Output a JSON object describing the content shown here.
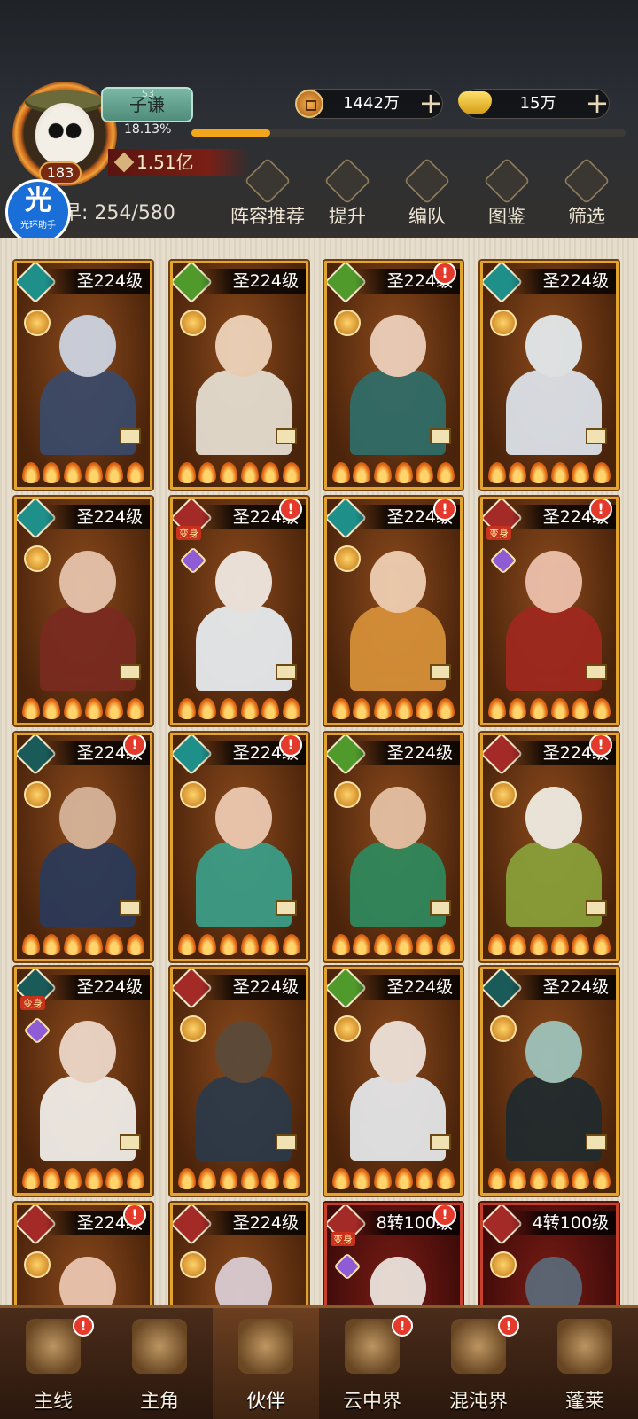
{
  "player": {
    "name": "子谦",
    "name_sup": "S3",
    "level": "183",
    "exp_percent_text": "18.13%",
    "exp_fraction": 0.1813,
    "power": "1.51亿",
    "capacity": "254/580",
    "capacity_prefix": "早"
  },
  "currency": {
    "copper": "1442万",
    "gold": "15万"
  },
  "helper_badge": {
    "glyph": "光",
    "label": "光环助手"
  },
  "header_buttons": [
    "阵容推荐",
    "提升",
    "编队",
    "图鉴",
    "筛选"
  ],
  "cards": [
    {
      "level": "圣224级",
      "elem": "teal",
      "alert": false
    },
    {
      "level": "圣224级",
      "elem": "green",
      "alert": false
    },
    {
      "level": "圣224级",
      "elem": "green",
      "alert": true
    },
    {
      "level": "圣224级",
      "elem": "teal",
      "alert": false
    },
    {
      "level": "圣224级",
      "elem": "teal",
      "alert": false
    },
    {
      "level": "圣224级",
      "elem": "red",
      "alert": true,
      "transform": "变身"
    },
    {
      "level": "圣224级",
      "elem": "teal",
      "alert": true
    },
    {
      "level": "圣224级",
      "elem": "red",
      "alert": true,
      "transform": "变身"
    },
    {
      "level": "圣224级",
      "elem": "dark",
      "alert": true
    },
    {
      "level": "圣224级",
      "elem": "teal",
      "alert": true
    },
    {
      "level": "圣224级",
      "elem": "green",
      "alert": false
    },
    {
      "level": "圣224级",
      "elem": "red",
      "alert": true
    },
    {
      "level": "圣224级",
      "elem": "dark",
      "alert": false,
      "transform": "变身"
    },
    {
      "level": "圣224级",
      "elem": "red",
      "alert": false
    },
    {
      "level": "圣224级",
      "elem": "green",
      "alert": false
    },
    {
      "level": "圣224级",
      "elem": "dark",
      "alert": false
    },
    {
      "level": "圣224级",
      "elem": "red",
      "alert": true
    },
    {
      "level": "圣224级",
      "elem": "red",
      "alert": false
    },
    {
      "level": "8转100级",
      "elem": "red",
      "alert": true,
      "transform": "变身",
      "red": true
    },
    {
      "level": "4转100级",
      "elem": "red",
      "alert": false,
      "red": true
    }
  ],
  "bottom_nav": [
    {
      "label": "主线",
      "alert": true
    },
    {
      "label": "主角",
      "alert": false
    },
    {
      "label": "伙伴",
      "alert": false,
      "active": true
    },
    {
      "label": "云中界",
      "alert": true
    },
    {
      "label": "混沌界",
      "alert": true
    },
    {
      "label": "蓬莱",
      "alert": false
    }
  ],
  "colors": {
    "card_border": "#e2a42e",
    "card_border_red": "#c9402a",
    "exp_fill": "#f3a51b",
    "alert": "#e43a2c"
  },
  "icons": {
    "copper": "copper-coin-icon",
    "gold": "gold-ingot-icon",
    "plus": "plus-icon",
    "alert": "exclamation-icon"
  },
  "alert_glyph": "!",
  "plus_glyph": "+"
}
